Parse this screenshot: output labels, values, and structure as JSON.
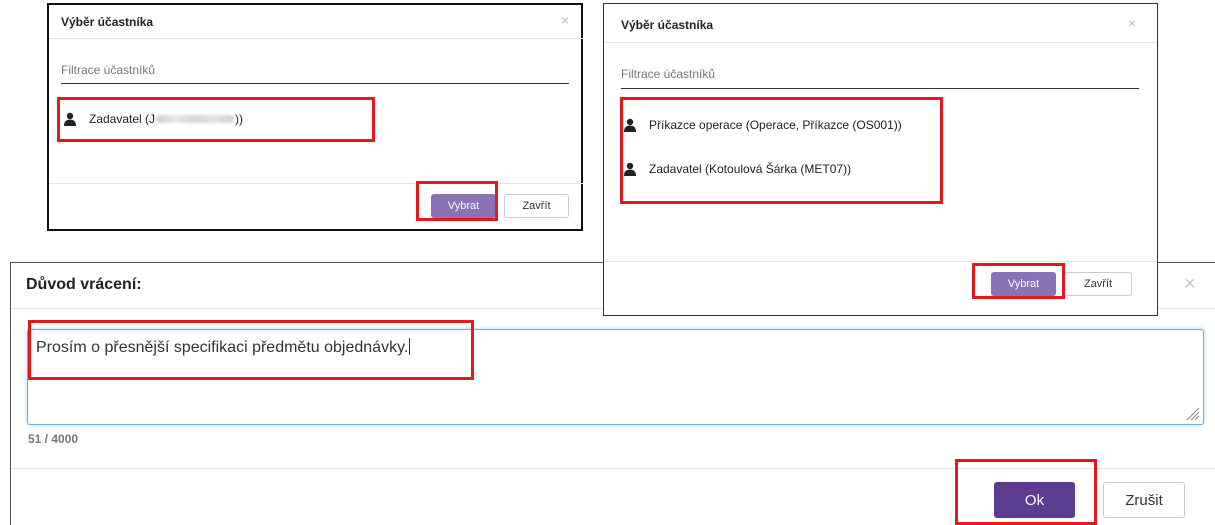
{
  "dialog_single": {
    "title": "Výběr účastníka",
    "close": "×",
    "filter_placeholder": "Filtrace účastníků",
    "participant_prefix": "Zadavatel (J",
    "participant_suffix": "))",
    "select_label": "Vybrat",
    "close_label": "Zavřít"
  },
  "dialog_multi": {
    "title": "Výběr účastníka",
    "close": "×",
    "filter_placeholder": "Filtrace účastníků",
    "participants": [
      "Příkazce operace (Operace, Příkazce (OS001))",
      "Zadavatel (Kotoulová Šárka (MET07))"
    ],
    "select_label": "Vybrat",
    "close_label": "Zavřít"
  },
  "return_dialog": {
    "title": "Důvod vrácení:",
    "close": "×",
    "reason_text": "Prosím o přesnější specifikaci předmětu objednávky.",
    "counter": "51 / 4000",
    "ok_label": "Ok",
    "cancel_label": "Zrušit"
  },
  "icons": {
    "person": "person-icon",
    "close": "close-icon",
    "resize": "resize-grip-icon"
  },
  "colors": {
    "primary_light": "#8a72b6",
    "primary_dark": "#5d3d8f",
    "highlight": "#e3191d",
    "focus_border": "#66afe9"
  }
}
